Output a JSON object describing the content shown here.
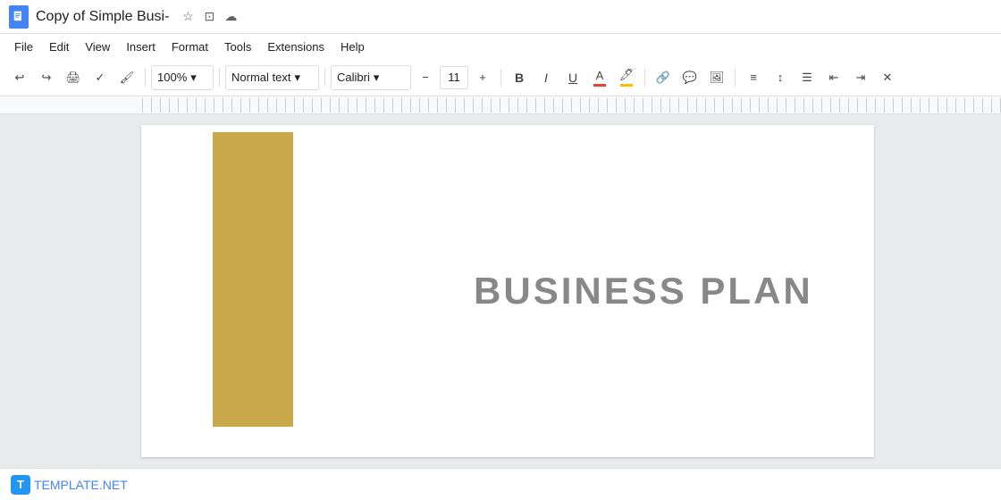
{
  "title_bar": {
    "title": "Copy of Simple Busi-",
    "star_icon": "★",
    "folder_icon": "📁",
    "cloud_icon": "☁"
  },
  "menu": {
    "items": [
      "File",
      "Edit",
      "View",
      "Insert",
      "Format",
      "Tools",
      "Extensions",
      "Help"
    ]
  },
  "toolbar": {
    "zoom": "100%",
    "font_style": "Normal text",
    "font_name": "Calibri",
    "font_size": "11",
    "bold_label": "B",
    "italic_label": "I",
    "underline_label": "U"
  },
  "document": {
    "heading": "BUSINESS PLAN"
  },
  "footer": {
    "brand_letter": "T",
    "brand_name": "TEMPLATE",
    "brand_dot": ".",
    "brand_net": "NET"
  }
}
